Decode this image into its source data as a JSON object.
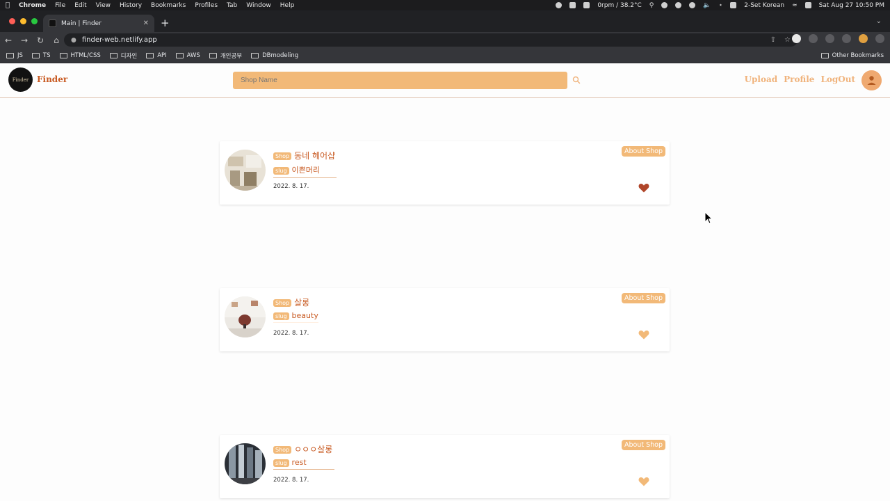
{
  "menubar": {
    "app": "Chrome",
    "items": [
      "File",
      "Edit",
      "View",
      "History",
      "Bookmarks",
      "Profiles",
      "Tab",
      "Window",
      "Help"
    ],
    "status_temp": "0rpm / 38.2°C",
    "input_method": "2-Set Korean",
    "clock": "Sat Aug 27  10:50 PM"
  },
  "browser": {
    "tab_title": "Main | Finder",
    "url": "finder-web.netlify.app",
    "bookmarks": [
      "JS",
      "TS",
      "HTML/CSS",
      "디자인",
      "API",
      "AWS",
      "개인공부",
      "DBmodeling"
    ],
    "other_bookmarks": "Other Bookmarks"
  },
  "header": {
    "logo_text": "Finder",
    "brand": "Finder",
    "search_placeholder": "Shop Name",
    "nav": {
      "upload": "Upload",
      "profile": "Profile",
      "logout": "LogOut"
    }
  },
  "cards": [
    {
      "shop_tag": "Shop",
      "name": "동네 헤어샵",
      "slug_tag": "slug",
      "slug": "이쁜머리",
      "date": "2022. 8. 17.",
      "about": "About Shop",
      "liked": true
    },
    {
      "shop_tag": "Shop",
      "name": "살롱",
      "slug_tag": "slug",
      "slug": "beauty",
      "date": "2022. 8. 17.",
      "about": "About Shop",
      "liked": false
    },
    {
      "shop_tag": "Shop",
      "name": "ㅇㅇㅇ살롱",
      "slug_tag": "slug",
      "slug": "rest",
      "date": "2022. 8. 17.",
      "about": "About Shop",
      "liked": false
    }
  ],
  "colors": {
    "accent": "#f2b978",
    "brand": "#c85a22",
    "heart_liked": "#b0462a",
    "heart_unliked": "#f2b978"
  }
}
